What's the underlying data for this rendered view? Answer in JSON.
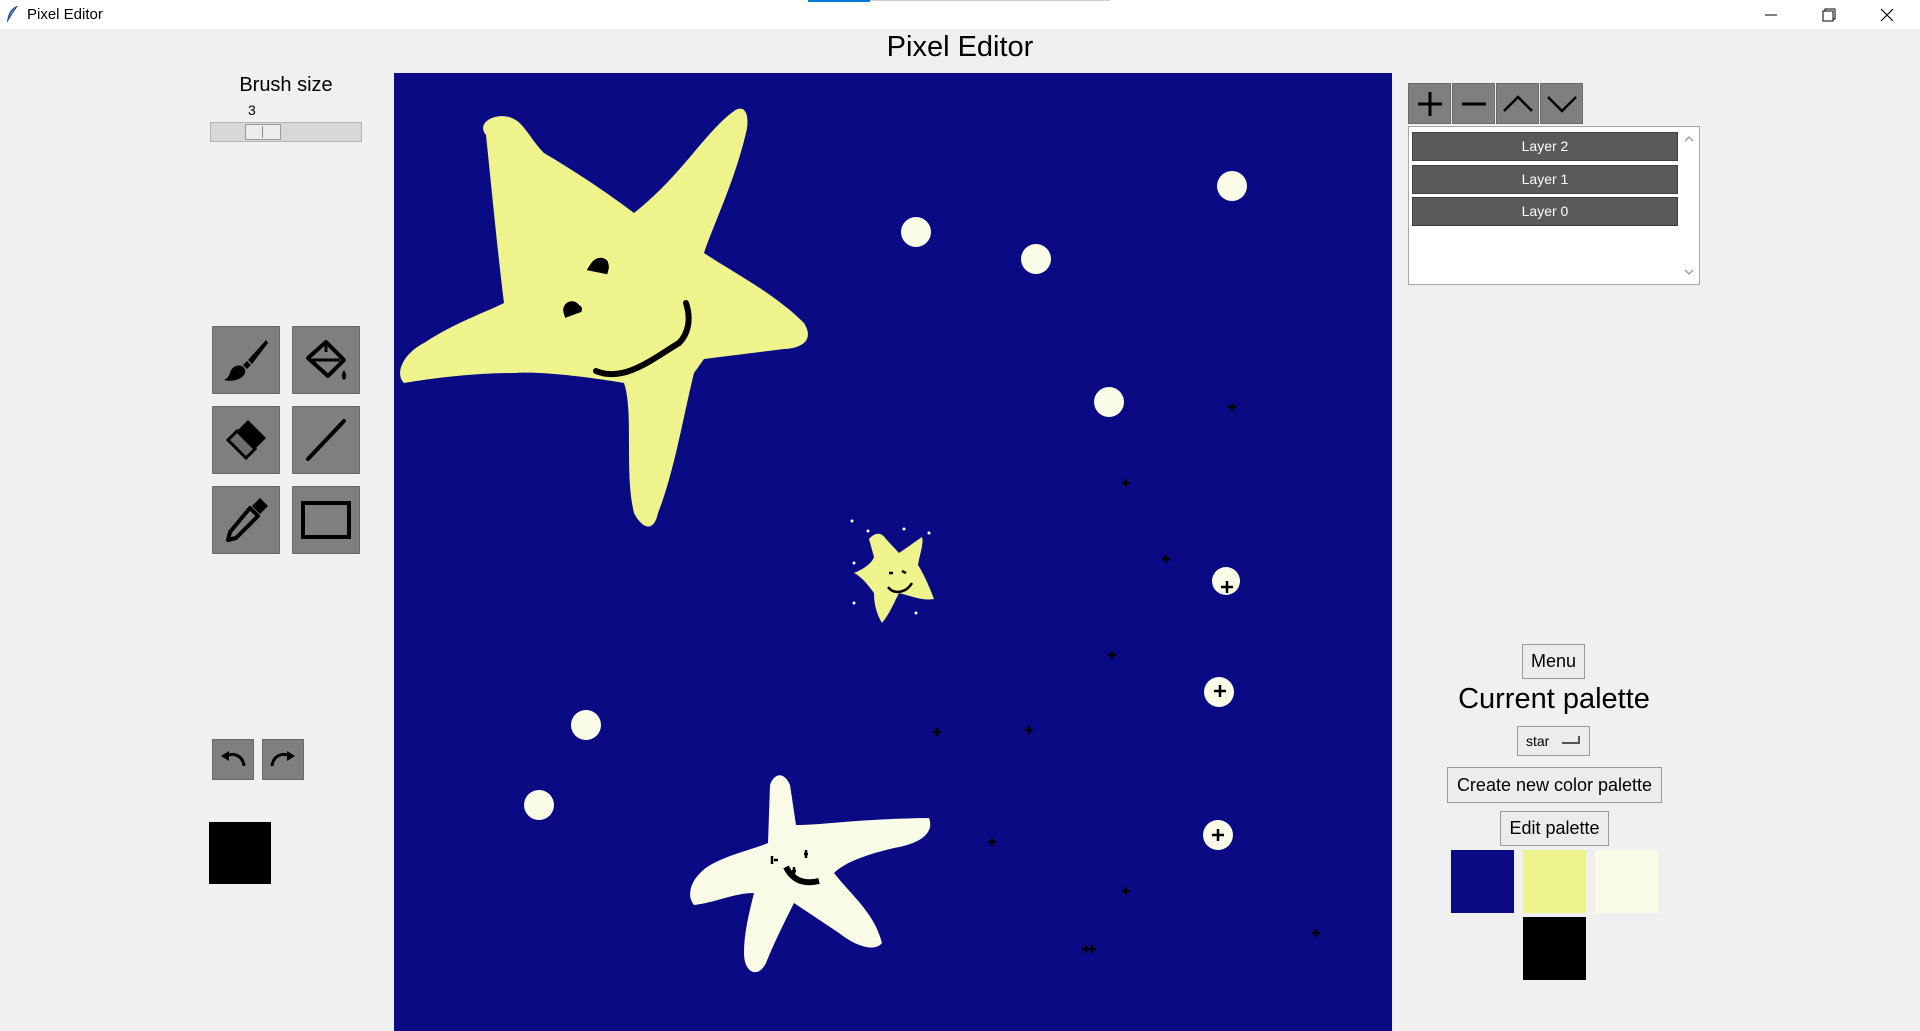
{
  "window": {
    "title": "Pixel Editor",
    "controls": [
      "minimize",
      "maximize",
      "close"
    ]
  },
  "header": {
    "title": "Pixel Editor"
  },
  "brush": {
    "label": "Brush size",
    "value": "3",
    "level": 0.3
  },
  "tools": [
    {
      "id": "brush",
      "icon": "paintbrush-icon"
    },
    {
      "id": "fill",
      "icon": "paint-bucket-icon"
    },
    {
      "id": "eraser",
      "icon": "eraser-icon"
    },
    {
      "id": "line",
      "icon": "line-icon"
    },
    {
      "id": "eyedropper",
      "icon": "eyedropper-icon"
    },
    {
      "id": "rectangle",
      "icon": "rectangle-icon"
    }
  ],
  "history": {
    "undo_icon": "undo-icon",
    "redo_icon": "redo-icon"
  },
  "current_color": "#000000",
  "canvas": {
    "background": "#0a0a85",
    "drawing": "three smiling stars, white dots and small black crosses on a dark blue background"
  },
  "layers": {
    "toolbar": [
      "add-layer-icon",
      "remove-layer-icon",
      "move-layer-up-icon",
      "move-layer-down-icon"
    ],
    "items": [
      {
        "label": "Layer 2"
      },
      {
        "label": "Layer 1"
      },
      {
        "label": "Layer 0"
      }
    ]
  },
  "palette": {
    "menu_label": "Menu",
    "heading": "Current palette",
    "selected": "star",
    "create_label": "Create new color palette",
    "edit_label": "Edit palette",
    "colors": [
      "#0a0a85",
      "#eef38c",
      "#fafbe7",
      "#000000"
    ]
  }
}
